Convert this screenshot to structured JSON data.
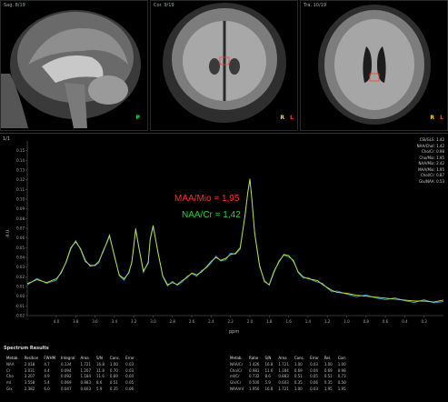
{
  "mri": {
    "panes": [
      {
        "id": "sagittal",
        "top_left": "Sag. 8/19",
        "top_right": "",
        "orient_h": "P",
        "orient_v": "",
        "accent": "#1aff3a"
      },
      {
        "id": "coronal",
        "top_left": "Cor. 9/19",
        "top_right": "",
        "orient_h": "R",
        "orient_v": "L",
        "accent": "#ff3b30"
      },
      {
        "id": "axial",
        "top_left": "Tra. 10/19",
        "top_right": "",
        "orient_h": "R",
        "orient_v": "L",
        "accent": "#ff3b30"
      }
    ]
  },
  "spectrum": {
    "corner_label": "1/1",
    "ratio_red": "MAA/Mio = 1,95",
    "ratio_green": "NAA/Cr = 1,42",
    "xaxis_title": "ppm",
    "yaxis_title": "a.u.",
    "legend": [
      "CSI/GLS: 1.42",
      "NAA/Chol: 1.42",
      "Cho/Cr: 0.98",
      "Cho/Mio: 1.95",
      "NAA/Mio: 2.42",
      "MAA/Mio: 1.95",
      "Chol/Cr: 0.87",
      "Glx/NAA: 0.53"
    ],
    "colors": {
      "fit": "#c8e03a",
      "data": "#2aa8d8",
      "ratio_red": "#ff2d2d",
      "ratio_green": "#2ecc40",
      "peak_label": "#39c5ff"
    }
  },
  "chart_data": {
    "type": "line",
    "x_reversed": true,
    "xlim": [
      4.3,
      0.0
    ],
    "ylim": [
      -0.02,
      0.16
    ],
    "xticks": [
      "4.0",
      "3.8",
      "3.6",
      "3.4",
      "3.2",
      "3.0",
      "2.8",
      "2.6",
      "2.4",
      "2.2",
      "2.0",
      "1.8",
      "1.6",
      "1.4",
      "1.2",
      "1.0",
      "0.8",
      "0.6",
      "0.4",
      "0.2"
    ],
    "yticks": [
      "-0.02",
      "-0.01",
      "0.00",
      "0.01",
      "0.02",
      "0.03",
      "0.04",
      "0.05",
      "0.06",
      "0.07",
      "0.08",
      "0.09",
      "0.10",
      "0.11",
      "0.12",
      "0.13",
      "0.14",
      "0.15"
    ],
    "series": [
      {
        "x": [
          4.3,
          4.2,
          4.1,
          4.0,
          3.95,
          3.9,
          3.85,
          3.8,
          3.75,
          3.7,
          3.65,
          3.6,
          3.56,
          3.52,
          3.48,
          3.45,
          3.4,
          3.35,
          3.3,
          3.25,
          3.22,
          3.2,
          3.18,
          3.15,
          3.1,
          3.05,
          3.03,
          3.0,
          2.95,
          2.9,
          2.85,
          2.8,
          2.75,
          2.7,
          2.65,
          2.6,
          2.55,
          2.5,
          2.45,
          2.4,
          2.35,
          2.3,
          2.25,
          2.2,
          2.15,
          2.1,
          2.05,
          2.02,
          2.0,
          1.98,
          1.95,
          1.9,
          1.85,
          1.8,
          1.75,
          1.7,
          1.65,
          1.6,
          1.55,
          1.5,
          1.45,
          1.4,
          1.35,
          1.3,
          1.25,
          1.2,
          1.15,
          1.1,
          1.0,
          0.9,
          0.8,
          0.7,
          0.6,
          0.5,
          0.4,
          0.3,
          0.2,
          0.1,
          0.0
        ],
        "y": [
          0.013,
          0.017,
          0.014,
          0.018,
          0.024,
          0.035,
          0.05,
          0.056,
          0.049,
          0.037,
          0.031,
          0.032,
          0.036,
          0.045,
          0.055,
          0.063,
          0.041,
          0.022,
          0.018,
          0.024,
          0.035,
          0.052,
          0.069,
          0.052,
          0.026,
          0.034,
          0.059,
          0.073,
          0.045,
          0.021,
          0.012,
          0.014,
          0.012,
          0.016,
          0.019,
          0.024,
          0.022,
          0.025,
          0.03,
          0.036,
          0.04,
          0.037,
          0.039,
          0.043,
          0.044,
          0.05,
          0.083,
          0.108,
          0.121,
          0.1,
          0.065,
          0.032,
          0.015,
          0.012,
          0.026,
          0.035,
          0.043,
          0.042,
          0.036,
          0.025,
          0.02,
          0.018,
          0.017,
          0.016,
          0.012,
          0.009,
          0.006,
          0.004,
          0.003,
          0.001,
          0.0,
          -0.001,
          -0.002,
          -0.003,
          -0.004,
          -0.005,
          -0.005,
          -0.006,
          -0.004
        ]
      }
    ]
  },
  "results": {
    "title": "Spectrum Results",
    "left_header": [
      "Metab.",
      "Position",
      "FWHM",
      "Integral",
      "Area",
      "S/N",
      "Conc.",
      "Error"
    ],
    "left_rows": [
      [
        "NAA",
        "2.018",
        "4.7",
        "0.134",
        "1.721",
        "16.8",
        "1.00",
        "0.03"
      ],
      [
        "Cr",
        "3.031",
        "4.4",
        "0.094",
        "1.207",
        "11.8",
        "0.70",
        "0.03"
      ],
      [
        "Cho",
        "3.207",
        "4.9",
        "0.092",
        "1.184",
        "11.6",
        "0.69",
        "0.04"
      ],
      [
        "mI",
        "3.558",
        "5.4",
        "0.069",
        "0.883",
        "8.6",
        "0.51",
        "0.05"
      ],
      [
        "Glx",
        "2.382",
        "6.0",
        "0.047",
        "0.603",
        "5.9",
        "0.35",
        "0.06"
      ]
    ],
    "right_header": [
      "Metab.",
      "Ratio",
      "S/N",
      "Area",
      "Conc.",
      "Error",
      "Rel.",
      "Corr."
    ],
    "right_rows": [
      [
        "NAA/Cr",
        "1.426",
        "16.8",
        "1.721",
        "1.00",
        "0.03",
        "1.00",
        "1.00"
      ],
      [
        "Cho/Cr",
        "0.981",
        "11.6",
        "1.184",
        "0.69",
        "0.04",
        "0.69",
        "0.98"
      ],
      [
        "mI/Cr",
        "0.732",
        "8.6",
        "0.883",
        "0.51",
        "0.05",
        "0.51",
        "0.73"
      ],
      [
        "Glx/Cr",
        "0.500",
        "5.9",
        "0.603",
        "0.35",
        "0.06",
        "0.35",
        "0.50"
      ],
      [
        "NAA/mI",
        "1.950",
        "16.8",
        "1.721",
        "1.00",
        "0.03",
        "1.95",
        "1.95"
      ]
    ]
  }
}
